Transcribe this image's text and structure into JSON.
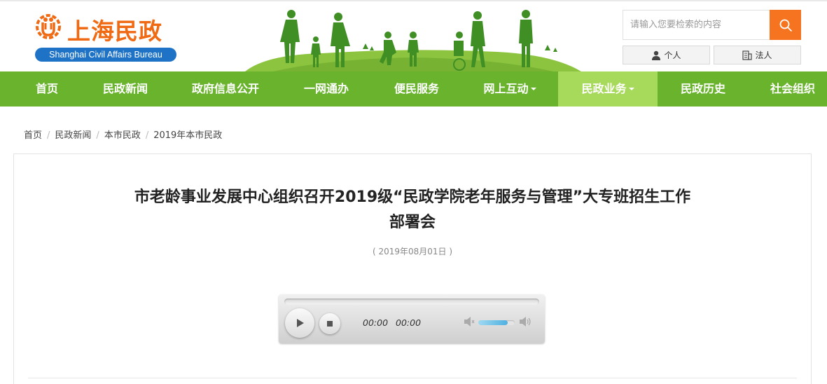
{
  "site": {
    "name_cn": "上海民政",
    "name_en": "Shanghai Civil Affairs Bureau",
    "brand_orange": "#f06a14",
    "brand_blue": "#1f73c6",
    "nav_green": "#6ab42d",
    "nav_active_green": "#a7d95a"
  },
  "search": {
    "placeholder": "请输入您要检索的内容",
    "button_icon": "search-icon",
    "button_color": "#f6731f"
  },
  "user_type": {
    "personal": "个人",
    "personal_icon": "person-icon",
    "legal": "法人",
    "legal_icon": "building-icon"
  },
  "nav": {
    "items": [
      {
        "label": "首页"
      },
      {
        "label": "民政新闻"
      },
      {
        "label": "政府信息公开"
      },
      {
        "label": "一网通办"
      },
      {
        "label": "便民服务"
      },
      {
        "label": "网上互动",
        "dropdown": true
      },
      {
        "label": "民政业务",
        "dropdown": true,
        "active": true
      },
      {
        "label": "民政历史"
      },
      {
        "label": "社会组织"
      }
    ]
  },
  "breadcrumb": [
    "首页",
    "民政新闻",
    "本市民政",
    "2019年本市民政"
  ],
  "article": {
    "title_line1": "市老龄事业发展中心组织召开2019级“民政学院老年服务与管理”大专班招生工作",
    "title_line2": "部署会",
    "date": "( 2019年08月01日 )"
  },
  "audio": {
    "current_time": "00:00",
    "duration": "00:00",
    "progress": 0,
    "volume": 0.8
  }
}
